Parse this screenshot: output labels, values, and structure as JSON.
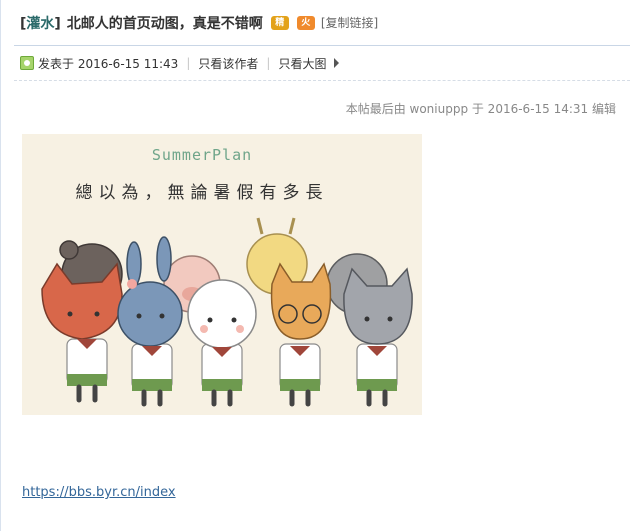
{
  "title": {
    "category": "灌水",
    "text": "北邮人的首页动图，真是不错啊",
    "badges": [
      "精",
      "火"
    ],
    "copy_link": "[复制链接]"
  },
  "meta": {
    "posted_at": "发表于 2016-6-15 11:43",
    "only_author": "只看该作者",
    "big_image": "只看大图"
  },
  "edit_note": "本帖最后由 woniuppp 于 2016-6-15 14:31 编辑",
  "image": {
    "title": "SummerPlan",
    "caption": "總以為，無論暑假有多長"
  },
  "link": "https://bbs.byr.cn/index",
  "colors": {
    "link": "#336699",
    "category": "#2b6a6a",
    "badge_jing": "#e3a21a",
    "badge_huo": "#f08a2c"
  }
}
